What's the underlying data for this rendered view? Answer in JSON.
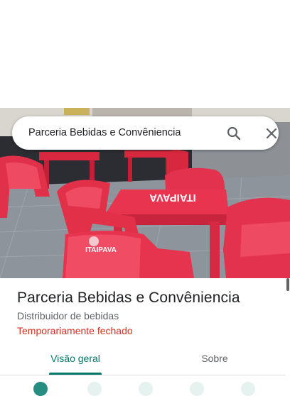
{
  "search": {
    "query": "Parceria Bebidas e Convêniencia"
  },
  "photo": {
    "sign_text_table": "ITAIPAVA",
    "sign_text_chair": "ITAIPAVA"
  },
  "place": {
    "title": "Parceria Bebidas e Convêniencia",
    "category": "Distribuidor de bebidas",
    "status": "Temporariamente fechado"
  },
  "tabs": [
    {
      "label": "Visão geral"
    },
    {
      "label": "Sobre"
    }
  ],
  "colors": {
    "accent": "#00796b",
    "status_closed": "#d93025"
  },
  "icons": [
    "search-icon",
    "close-icon"
  ]
}
